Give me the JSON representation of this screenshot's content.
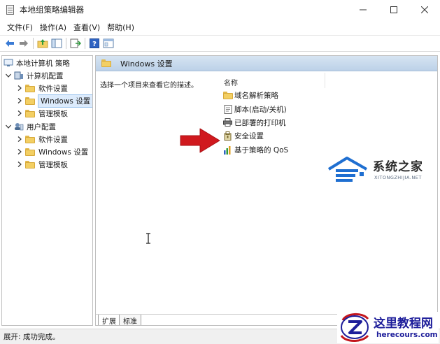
{
  "window": {
    "title": "本地组策略编辑器"
  },
  "menu": [
    "文件(F)",
    "操作(A)",
    "查看(V)",
    "帮助(H)"
  ],
  "toolbar": {
    "buttons": [
      "back-arrow-icon",
      "forward-arrow-icon",
      "up-folder-icon",
      "show-hide-tree-icon",
      "export-list-icon",
      "help-icon",
      "properties-icon"
    ]
  },
  "tree": {
    "root": "本地计算机 策略",
    "computer_config": "计算机配置",
    "computer_children": [
      "软件设置",
      "Windows 设置",
      "管理模板"
    ],
    "user_config": "用户配置",
    "user_children": [
      "软件设置",
      "Windows 设置",
      "管理模板"
    ],
    "selected": "Windows 设置"
  },
  "details": {
    "header_title": "Windows 设置",
    "description": "选择一个项目来查看它的描述。",
    "column_name": "名称",
    "items": [
      {
        "label": "域名解析策略",
        "icon": "folder-icon"
      },
      {
        "label": "脚本(启动/关机)",
        "icon": "script-icon"
      },
      {
        "label": "已部署的打印机",
        "icon": "printer-icon"
      },
      {
        "label": "安全设置",
        "icon": "security-settings-icon"
      },
      {
        "label": "基于策略的 QoS",
        "icon": "qos-chart-icon"
      }
    ]
  },
  "bottom_tabs": [
    "扩展",
    "标准"
  ],
  "status": {
    "text": "展开: 成功完成。"
  },
  "watermarks": {
    "site1_name": "系统之家",
    "site1_url": "XITONGZHIJIA.NET",
    "site2_name": "这里教程网",
    "site2_url": "herecours.com"
  },
  "colors": {
    "accent_selection": "#dcebfc",
    "header_blue": "#bcd1e8",
    "folder_yellow": "#f3cf63",
    "annotation_red": "#d0191e",
    "watermark_blue": "#1d1d9a"
  }
}
